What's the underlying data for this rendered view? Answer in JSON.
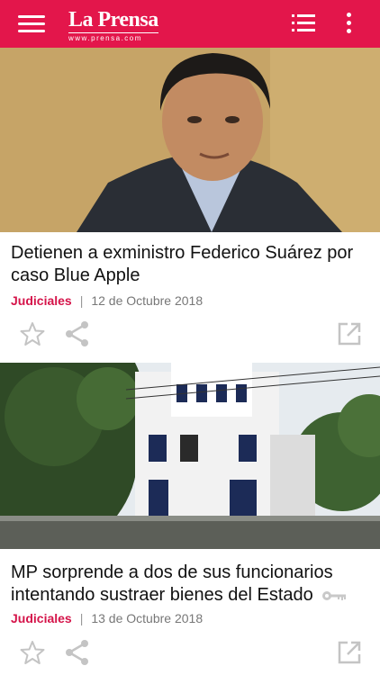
{
  "header": {
    "logo_title": "La Prensa",
    "logo_subtitle": "www.prensa.com",
    "brand_color": "#e3164b",
    "icons": [
      "hamburger-menu-icon",
      "list-icon",
      "more-vertical-icon"
    ]
  },
  "articles": [
    {
      "headline": "Detienen a exministro Federico Suárez por caso Blue Apple",
      "category": "Judiciales",
      "separator": "|",
      "date": "12 de Octubre 2018",
      "icons": [
        "star-icon",
        "share-icon",
        "external-link-icon"
      ]
    },
    {
      "headline": "MP sorprende a dos de sus funcionarios intentando sustraer bienes del Estado",
      "category": "Judiciales",
      "separator": "|",
      "date": "13 de Octubre 2018",
      "icons": [
        "key-icon",
        "star-icon",
        "share-icon",
        "external-link-icon"
      ]
    }
  ],
  "colors": {
    "category": "#d5144a",
    "icon_gray": "#c4c4c4"
  }
}
